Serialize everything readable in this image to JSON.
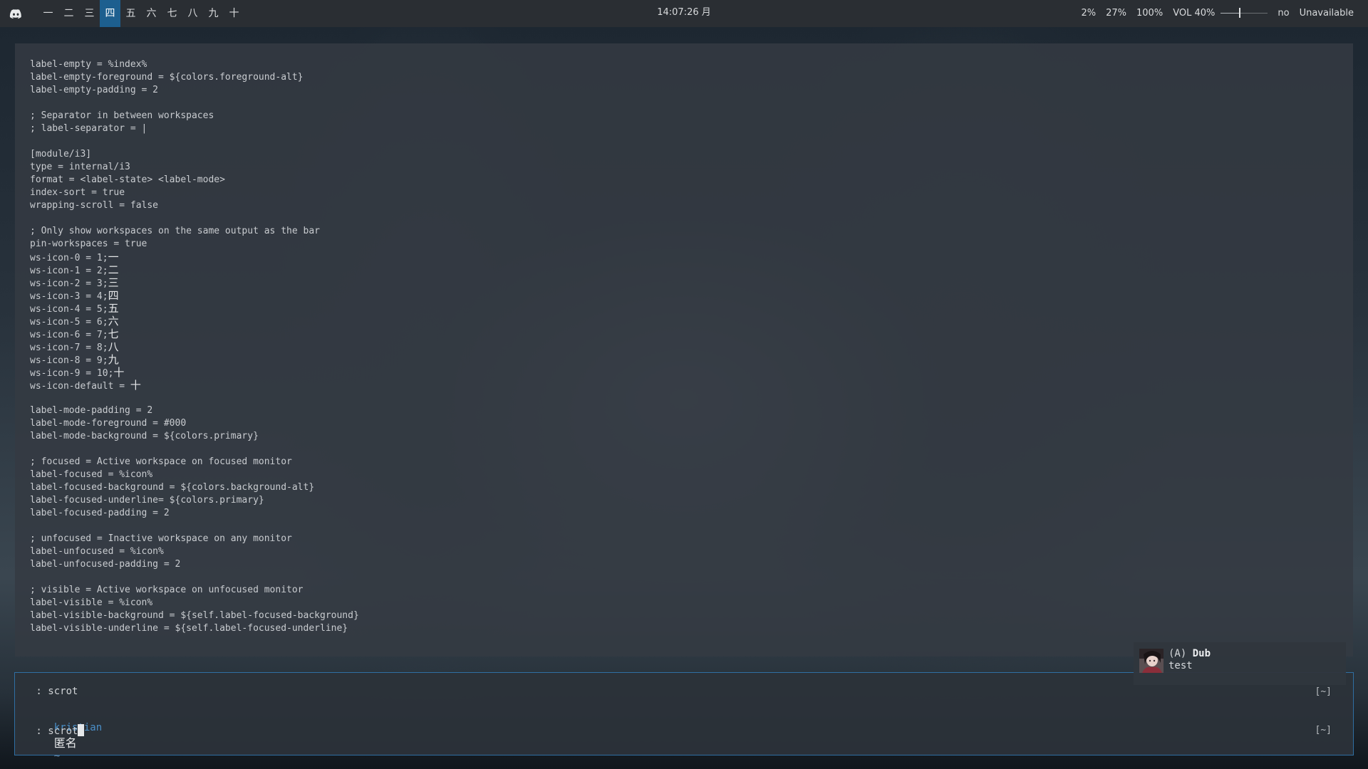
{
  "topbar": {
    "workspaces": [
      {
        "label": "一",
        "active": false
      },
      {
        "label": "二",
        "active": false
      },
      {
        "label": "三",
        "active": false
      },
      {
        "label": "四",
        "active": true
      },
      {
        "label": "五",
        "active": false
      },
      {
        "label": "六",
        "active": false
      },
      {
        "label": "七",
        "active": false
      },
      {
        "label": "八",
        "active": false
      },
      {
        "label": "九",
        "active": false
      },
      {
        "label": "十",
        "active": false
      }
    ],
    "clock": "14:07:26 月",
    "status": {
      "stat1": "2%",
      "stat2": "27%",
      "stat3": "100%",
      "volume_label": "VOL 40%",
      "volume_level": 0.4,
      "extra": "no",
      "network": "Unavailable"
    },
    "accent_color": "#1d5f8f"
  },
  "editor": {
    "lines": [
      "label-empty = %index%",
      "label-empty-foreground = ${colors.foreground-alt}",
      "label-empty-padding = 2",
      "",
      "; Separator in between workspaces",
      "; label-separator = |",
      "",
      "[module/i3]",
      "type = internal/i3",
      "format = <label-state> <label-mode>",
      "index-sort = true",
      "wrapping-scroll = false",
      "",
      "; Only show workspaces on the same output as the bar",
      "pin-workspaces = true",
      "ws-icon-0 = 1;",
      "ws-icon-1 = 2;",
      "ws-icon-2 = 3;",
      "ws-icon-3 = 4;",
      "ws-icon-4 = 5;",
      "ws-icon-5 = 6;",
      "ws-icon-6 = 7;",
      "ws-icon-7 = 8;",
      "ws-icon-8 = 9;",
      "ws-icon-9 = 10;",
      "ws-icon-default = ",
      "",
      "label-mode-padding = 2",
      "label-mode-foreground = #000",
      "label-mode-background = ${colors.primary}",
      "",
      "; focused = Active workspace on focused monitor",
      "label-focused = %icon%",
      "label-focused-background = ${colors.background-alt}",
      "label-focused-underline= ${colors.primary}",
      "label-focused-padding = 2",
      "",
      "; unfocused = Inactive workspace on any monitor",
      "label-unfocused = %icon%",
      "label-unfocused-padding = 2",
      "",
      "; visible = Active workspace on unfocused monitor",
      "label-visible = %icon%",
      "label-visible-background = ${self.label-focused-background}",
      "label-visible-underline = ${self.label-focused-underline}"
    ],
    "icon_glyphs": {
      "15": "一",
      "16": "二",
      "17": "三",
      "18": "四",
      "19": "五",
      "20": "六",
      "21": "七",
      "22": "八",
      "23": "九",
      "24": "十",
      "25": "十"
    }
  },
  "shell": {
    "history_line": " : scrot",
    "history_dir": "[~]",
    "prompt_user": "kristian",
    "prompt_name": "匿名",
    "prompt_dir": "~",
    "command_line": " : scrot",
    "command_dir": "[~]"
  },
  "notification": {
    "title_prefix": "(A)",
    "title": "Dub",
    "body": "test"
  }
}
